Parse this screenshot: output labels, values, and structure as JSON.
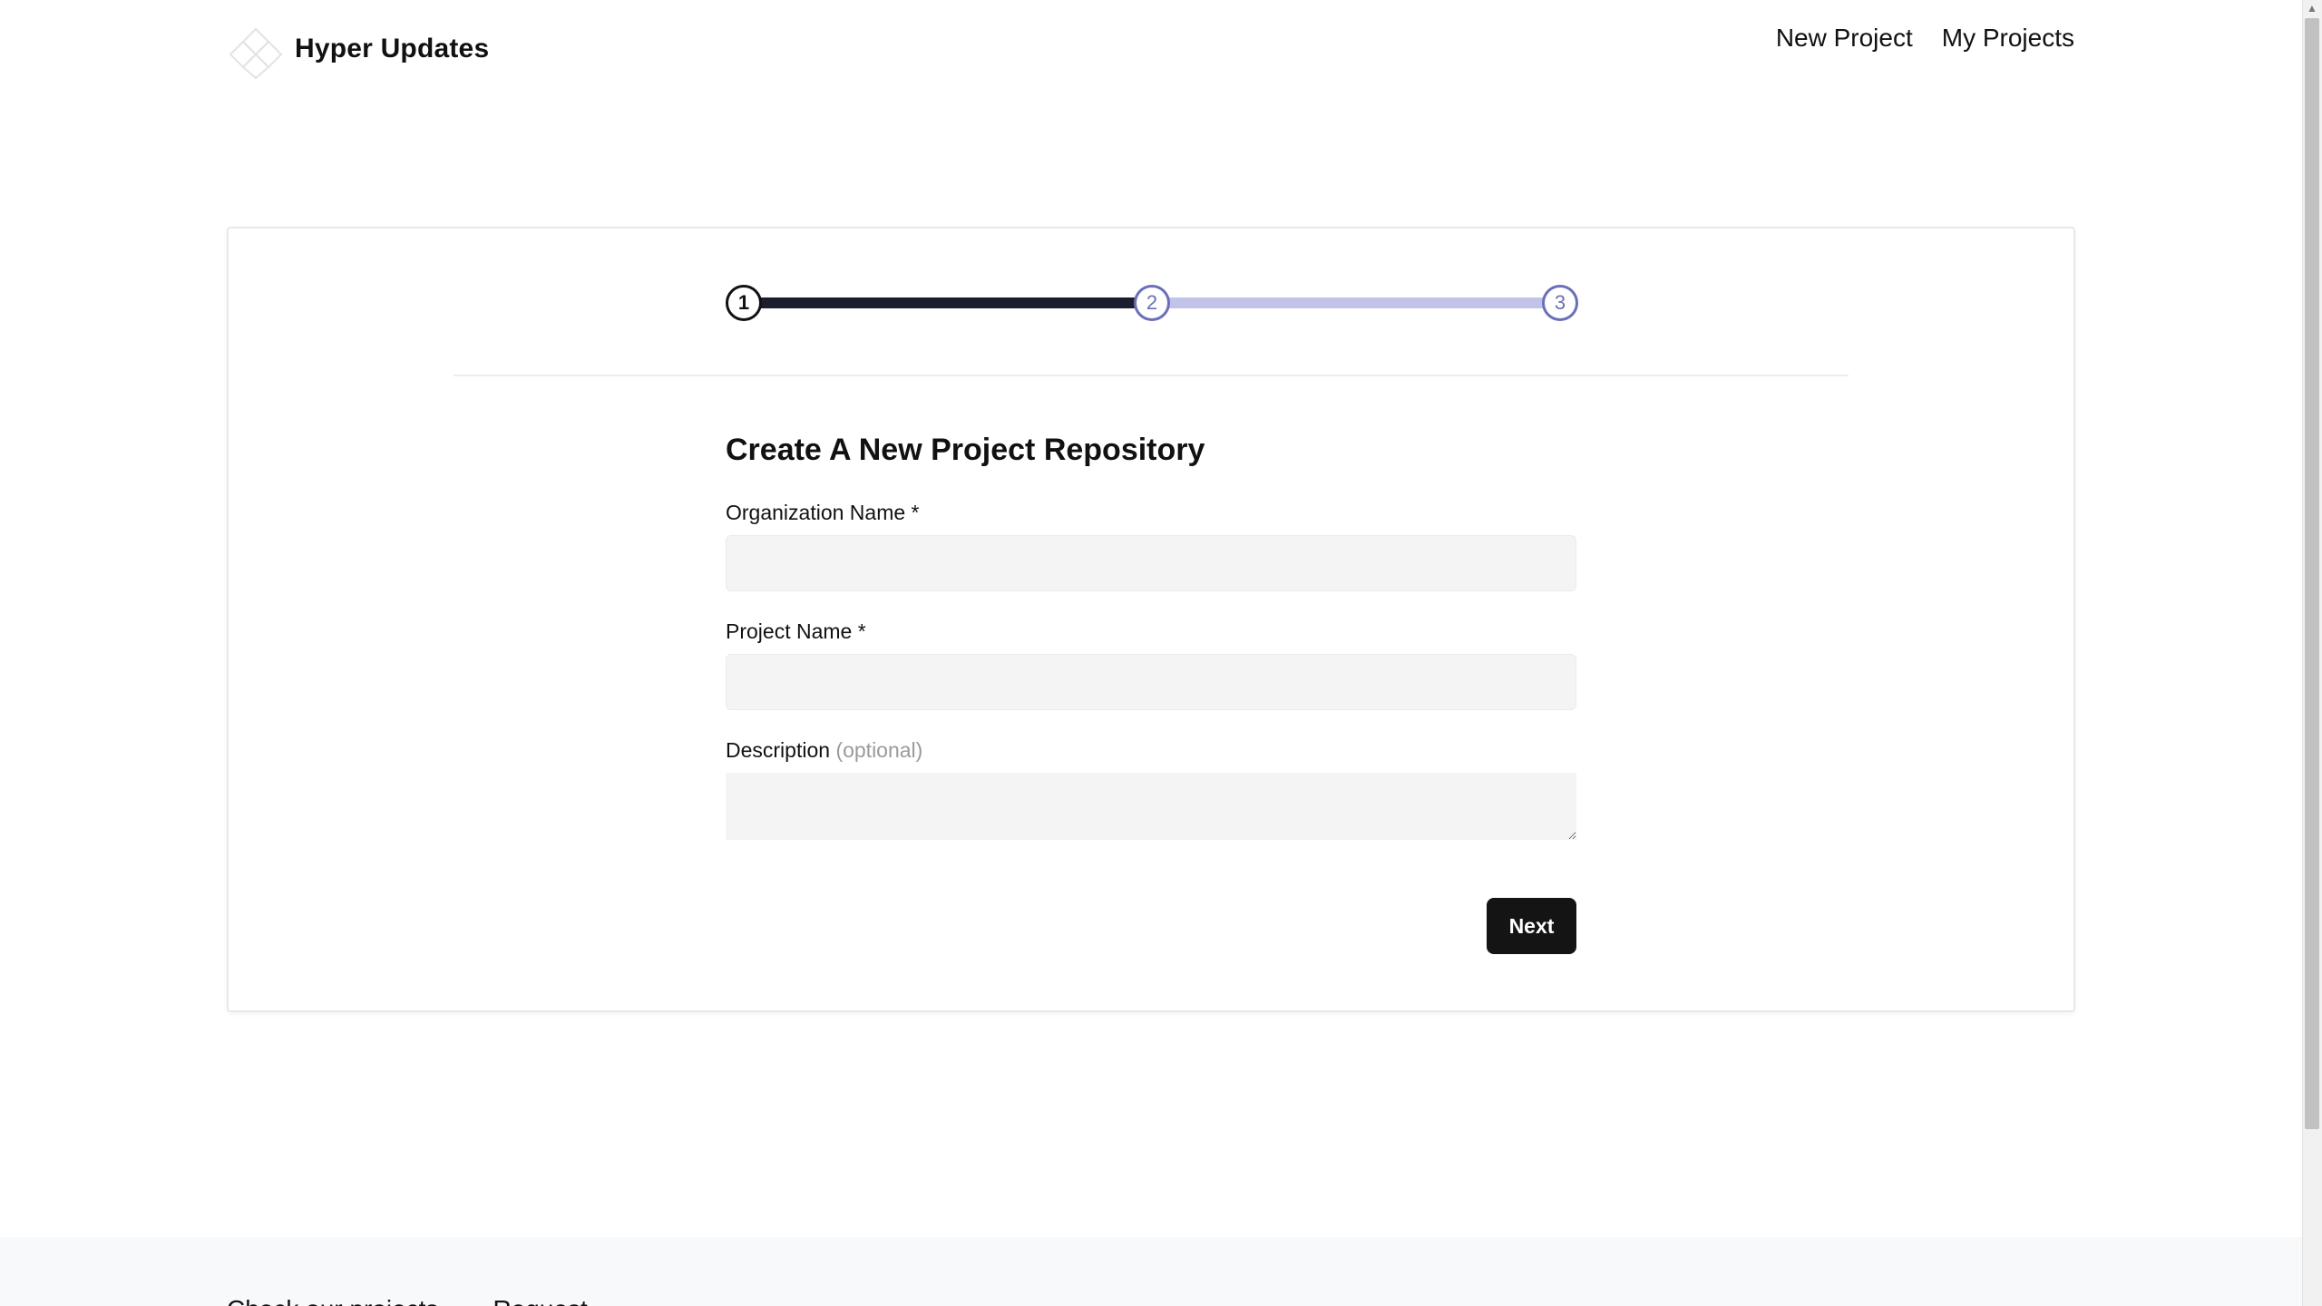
{
  "header": {
    "brand": "Hyper Updates",
    "nav": [
      "New Project",
      "My Projects"
    ]
  },
  "stepper": {
    "steps": [
      "1",
      "2",
      "3"
    ],
    "current": 1,
    "colors": {
      "done": "#1a1e2e",
      "todo": "#c2c3e8",
      "todo_circle": "#6a6fb8"
    }
  },
  "form": {
    "title": "Create A New Project Repository",
    "org_label": "Organization Name *",
    "org_value": "",
    "project_label": "Project Name *",
    "project_value": "",
    "desc_label": "Description",
    "desc_optional": "(optional)",
    "desc_value": "",
    "next_label": "Next"
  },
  "footer": {
    "links": [
      "Check our projects",
      "Request"
    ]
  }
}
